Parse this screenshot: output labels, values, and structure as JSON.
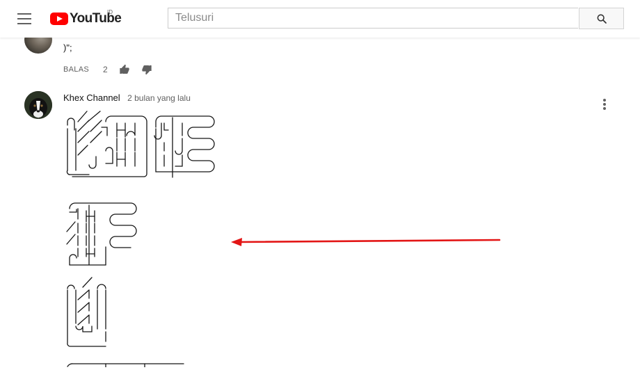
{
  "header": {
    "logo_text": "YouTube",
    "country_code": "ID",
    "search_placeholder": "Telusuri",
    "search_value": ""
  },
  "prev_comment": {
    "text": ")\";",
    "reply_label": "BALAS",
    "like_count": "2"
  },
  "comment": {
    "author": "Khex Channel",
    "time": "2 bulan yang lalu"
  },
  "annotation": {
    "arrow_color": "#e31515"
  },
  "colors": {
    "brand_red": "#ff0000",
    "icon_grey": "#606060"
  }
}
